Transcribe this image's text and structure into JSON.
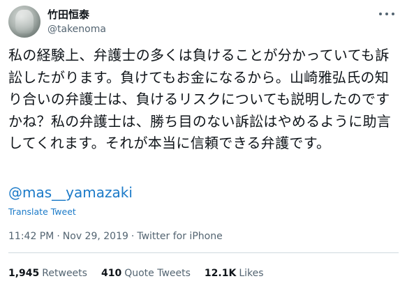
{
  "author": {
    "display_name": "竹田恒泰",
    "handle": "@takenoma"
  },
  "tweet": {
    "text": "私の経験上、弁護士の多くは負けることが分かっていても訴訟したがります。負けてもお金になるから。山崎雅弘氏の知り合いの弁護士は、負けるリスクについても説明したのですかね？私の弁護士は、勝ち目のない訴訟はやめるように助言してくれます。それが本当に信頼できる弁護です。",
    "mention": "@mas__yamazaki",
    "translate_label": "Translate Tweet"
  },
  "meta": {
    "time": "11:42 PM",
    "separator1": "·",
    "date": "Nov 29, 2019",
    "separator2": "·",
    "source": "Twitter for iPhone"
  },
  "stats": {
    "retweets_count": "1,945",
    "retweets_label": "Retweets",
    "quotes_count": "410",
    "quotes_label": "Quote Tweets",
    "likes_count": "12.1K",
    "likes_label": "Likes"
  },
  "icons": {
    "more": "more-horizontal-icon",
    "avatar": "profile-photo"
  }
}
